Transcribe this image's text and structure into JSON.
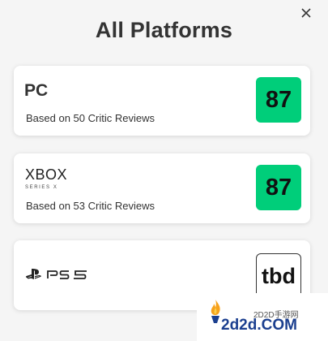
{
  "dialog": {
    "title": "All Platforms"
  },
  "platforms": [
    {
      "name": "PC",
      "reviews": "Based on 50 Critic Reviews",
      "score": "87"
    },
    {
      "name": "XBOX",
      "subname": "SERIES X",
      "reviews": "Based on 53 Critic Reviews",
      "score": "87"
    },
    {
      "name": "PS5",
      "score": "tbd"
    }
  ],
  "watermark": {
    "site": "2D2D手游网",
    "domain": "2d2d.COM"
  },
  "colors": {
    "score_green": "#00ce7a",
    "background": "#f5f5f5"
  },
  "icons": {
    "close": "close-icon",
    "playstation": "playstation-icon"
  }
}
